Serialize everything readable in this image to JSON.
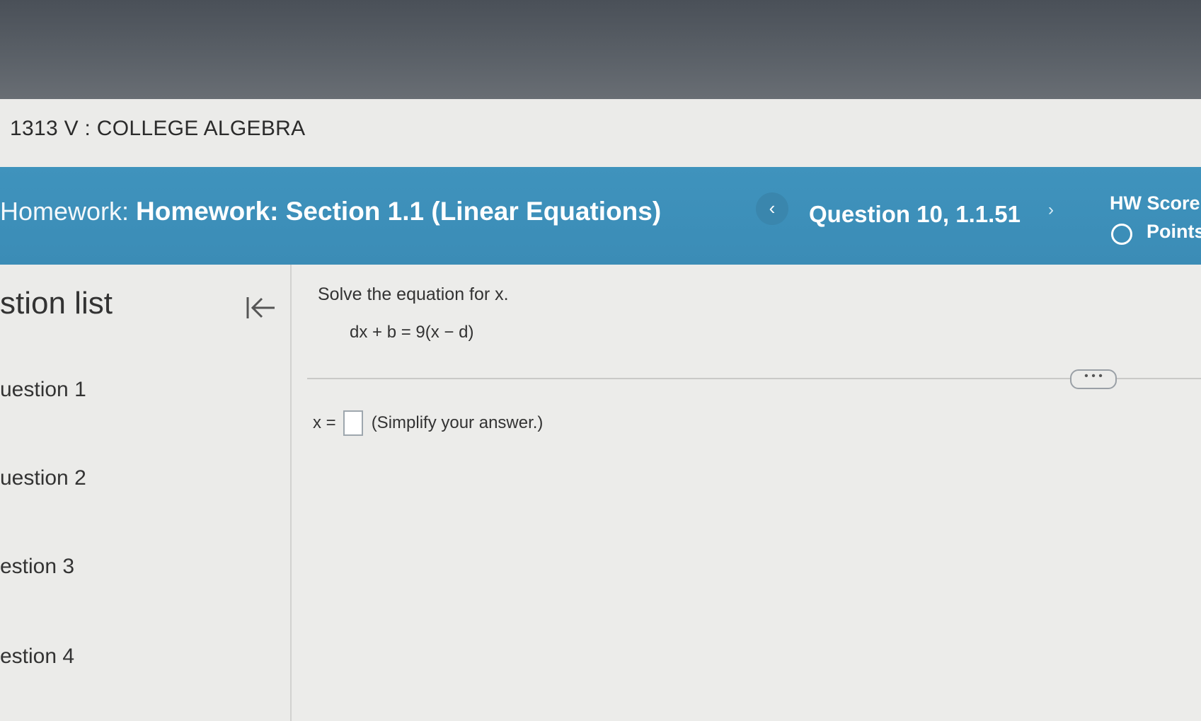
{
  "course": {
    "title": "1313 V : COLLEGE ALGEBRA"
  },
  "homework_bar": {
    "label": "Homework:",
    "name": "Homework: Section 1.1 (Linear Equations)",
    "prev_icon": "chevron-left-icon",
    "question_label": "Question 10, 1.1.51",
    "next_icon": "chevron-right-icon",
    "hw_score_label": "HW Score",
    "points_label": "Points"
  },
  "sidebar": {
    "title": "stion list",
    "collapse_icon": "collapse-left-icon",
    "items": [
      {
        "label": "uestion 1"
      },
      {
        "label": "uestion 2"
      },
      {
        "label": "estion 3"
      },
      {
        "label": "estion 4"
      }
    ]
  },
  "question": {
    "prompt": "Solve the equation for x.",
    "equation": "dx + b = 9(x − d)",
    "more_label": "• • •",
    "answer_prefix": "x =",
    "answer_value": "",
    "answer_hint": "(Simplify your answer.)"
  },
  "colors": {
    "header_blue": "#3f93bd",
    "text_dark": "#333333"
  }
}
